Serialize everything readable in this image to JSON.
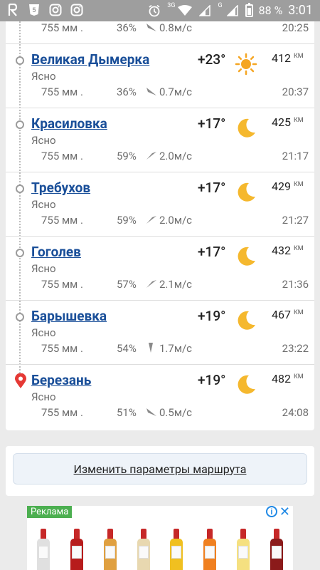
{
  "statusbar": {
    "network_label": "3G",
    "network_label2": "G",
    "battery": "88 %",
    "time": "3:01"
  },
  "partial": {
    "pressure": "755 мм .",
    "humidity": "36%",
    "wind": "0.8м/с",
    "time": "20:25"
  },
  "stops": [
    {
      "name": "Великая Дымерка",
      "condition": "Ясно",
      "temp": "+23°",
      "icon": "sun",
      "distance": "412",
      "unit": "КМ",
      "pressure": "755 мм .",
      "humidity": "36%",
      "wind": "0.7м/с",
      "time": "20:37",
      "marker": "dot"
    },
    {
      "name": "Красиловка",
      "condition": "Ясно",
      "temp": "+17°",
      "icon": "moon",
      "distance": "425",
      "unit": "КМ",
      "pressure": "755 мм .",
      "humidity": "59%",
      "wind": "2.0м/с",
      "time": "21:17",
      "marker": "dot"
    },
    {
      "name": "Требухов",
      "condition": "Ясно",
      "temp": "+17°",
      "icon": "moon",
      "distance": "429",
      "unit": "КМ",
      "pressure": "755 мм .",
      "humidity": "59%",
      "wind": "2.0м/с",
      "time": "21:27",
      "marker": "dot"
    },
    {
      "name": "Гоголев",
      "condition": "Ясно",
      "temp": "+17°",
      "icon": "moon",
      "distance": "432",
      "unit": "КМ",
      "pressure": "755 мм .",
      "humidity": "57%",
      "wind": "2.1м/с",
      "time": "21:36",
      "marker": "dot"
    },
    {
      "name": "Барышевка",
      "condition": "Ясно",
      "temp": "+19°",
      "icon": "moon",
      "distance": "467",
      "unit": "КМ",
      "pressure": "755 мм .",
      "humidity": "54%",
      "wind": "1.7м/с",
      "time": "23:22",
      "marker": "dot"
    },
    {
      "name": "Березань",
      "condition": "Ясно",
      "temp": "+19°",
      "icon": "moon",
      "distance": "482",
      "unit": "КМ",
      "pressure": "755 мм .",
      "humidity": "51%",
      "wind": "0.5м/с",
      "time": "24:08",
      "marker": "pin"
    }
  ],
  "route_button": "Изменить параметры маршрута",
  "ad": {
    "label": "Реклама",
    "info": "i",
    "close": "✕"
  },
  "colors": {
    "link": "#1a4f99",
    "pin": "#e53935",
    "sun": "#f5a623",
    "moon": "#f5b82e"
  }
}
